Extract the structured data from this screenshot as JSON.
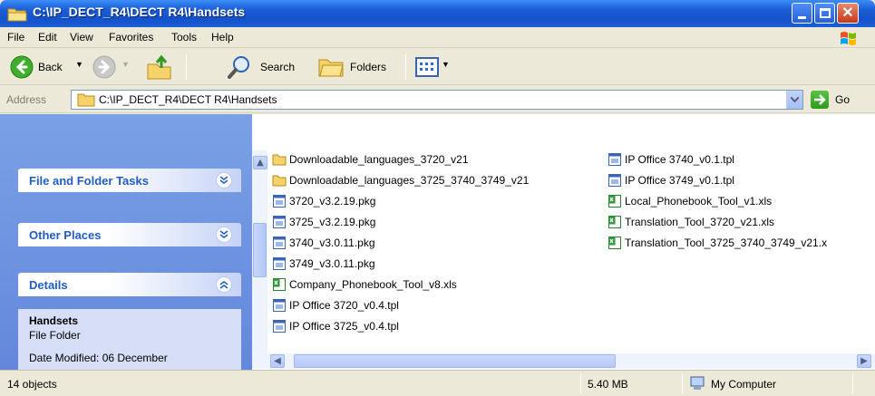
{
  "window": {
    "title": "C:\\IP_DECT_R4\\DECT R4\\Handsets"
  },
  "menu": [
    "File",
    "Edit",
    "View",
    "Favorites",
    "Tools",
    "Help"
  ],
  "toolbar": {
    "back_label": "Back",
    "search_label": "Search",
    "folders_label": "Folders"
  },
  "address": {
    "label": "Address",
    "value": "C:\\IP_DECT_R4\\DECT R4\\Handsets",
    "go_label": "Go"
  },
  "sidebar": {
    "panels": [
      {
        "title": "File and Folder Tasks"
      },
      {
        "title": "Other Places"
      },
      {
        "title": "Details"
      }
    ],
    "details": {
      "name": "Handsets",
      "type": "File Folder",
      "modified": "Date Modified: 06 December"
    }
  },
  "files": {
    "col1": [
      {
        "name": "Downloadable_languages_3720_v21",
        "icon": "folder-icon"
      },
      {
        "name": "Downloadable_languages_3725_3740_3749_v21",
        "icon": "folder-icon"
      },
      {
        "name": "3720_v3.2.19.pkg",
        "icon": "file-icon"
      },
      {
        "name": "3725_v3.2.19.pkg",
        "icon": "file-icon"
      },
      {
        "name": "3740_v3.0.11.pkg",
        "icon": "file-icon"
      },
      {
        "name": "3749_v3.0.11.pkg",
        "icon": "file-icon"
      },
      {
        "name": "Company_Phonebook_Tool_v8.xls",
        "icon": "excel-icon"
      },
      {
        "name": "IP Office 3720_v0.4.tpl",
        "icon": "file-icon"
      },
      {
        "name": "IP Office 3725_v0.4.tpl",
        "icon": "file-icon"
      }
    ],
    "col2": [
      {
        "name": "IP Office 3740_v0.1.tpl",
        "icon": "file-icon"
      },
      {
        "name": "IP Office 3749_v0.1.tpl",
        "icon": "file-icon"
      },
      {
        "name": "Local_Phonebook_Tool_v1.xls",
        "icon": "excel-icon"
      },
      {
        "name": "Translation_Tool_3720_v21.xls",
        "icon": "excel-icon"
      },
      {
        "name": "Translation_Tool_3725_3740_3749_v21.x",
        "icon": "excel-icon"
      }
    ]
  },
  "status": {
    "count": "14 objects",
    "size": "5.40 MB",
    "zone": "My Computer"
  },
  "colors": {
    "titlebar": "#1c5fd9",
    "sidebar": "#7aa1e6",
    "panel_title": "#215dc6"
  }
}
